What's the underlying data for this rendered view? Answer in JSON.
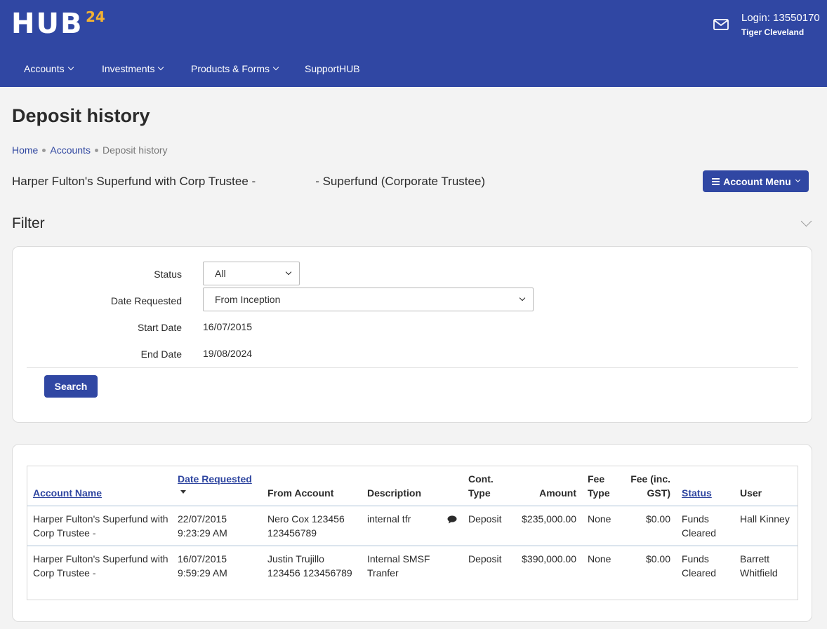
{
  "header": {
    "logo_text": "HUB",
    "logo_sup": "24",
    "login": "Login: 13550170",
    "user_name": "Tiger Cleveland",
    "brand_color": "#3047a3",
    "accent_color": "#f2b233"
  },
  "nav": {
    "items": [
      {
        "label": "Accounts",
        "has_dropdown": true
      },
      {
        "label": "Investments",
        "has_dropdown": true
      },
      {
        "label": "Products & Forms",
        "has_dropdown": true
      },
      {
        "label": "SupportHUB",
        "has_dropdown": false
      }
    ]
  },
  "page": {
    "title": "Deposit history",
    "breadcrumb": [
      "Home",
      "Accounts",
      "Deposit history"
    ],
    "account_title": "Harper Fulton's Superfund with Corp Trustee -                  - Superfund (Corporate Trustee)",
    "account_menu_label": "Account Menu"
  },
  "filter": {
    "title": "Filter",
    "status_label": "Status",
    "status_value": "All",
    "date_requested_label": "Date Requested",
    "date_requested_value": "From Inception",
    "start_date_label": "Start Date",
    "start_date_value": "16/07/2015",
    "end_date_label": "End Date",
    "end_date_value": "19/08/2024",
    "search_label": "Search"
  },
  "table": {
    "headers": {
      "account_name": "Account Name",
      "date_requested": "Date Requested",
      "from_account": "From Account",
      "description": "Description",
      "cont_type_1": "Cont.",
      "cont_type_2": "Type",
      "amount": "Amount",
      "fee_type_1": "Fee",
      "fee_type_2": "Type",
      "fee_gst_1": "Fee (inc.",
      "fee_gst_2": "GST)",
      "status": "Status",
      "user": "User"
    },
    "rows": [
      {
        "account_1": "Harper Fulton's Superfund with",
        "account_2": "Corp Trustee -",
        "date_1": "22/07/2015",
        "date_2": "9:23:29 AM",
        "from_1": "Nero Cox 123456",
        "from_2": "123456789",
        "desc_1": "internal tfr",
        "desc_2": "",
        "has_comment": true,
        "cont_type": "Deposit",
        "amount": "$235,000.00",
        "fee_type": "None",
        "fee": "$0.00",
        "status_1": "Funds",
        "status_2": "Cleared",
        "user_1": "Hall Kinney",
        "user_2": ""
      },
      {
        "account_1": "Harper Fulton's Superfund with",
        "account_2": "Corp Trustee -",
        "date_1": "16/07/2015",
        "date_2": "9:59:29 AM",
        "from_1": "Justin Trujillo",
        "from_2": "123456 123456789",
        "desc_1": "Internal SMSF",
        "desc_2": "Tranfer",
        "has_comment": false,
        "cont_type": "Deposit",
        "amount": "$390,000.00",
        "fee_type": "None",
        "fee": "$0.00",
        "status_1": "Funds",
        "status_2": "Cleared",
        "user_1": "Barrett",
        "user_2": "Whitfield"
      }
    ]
  }
}
